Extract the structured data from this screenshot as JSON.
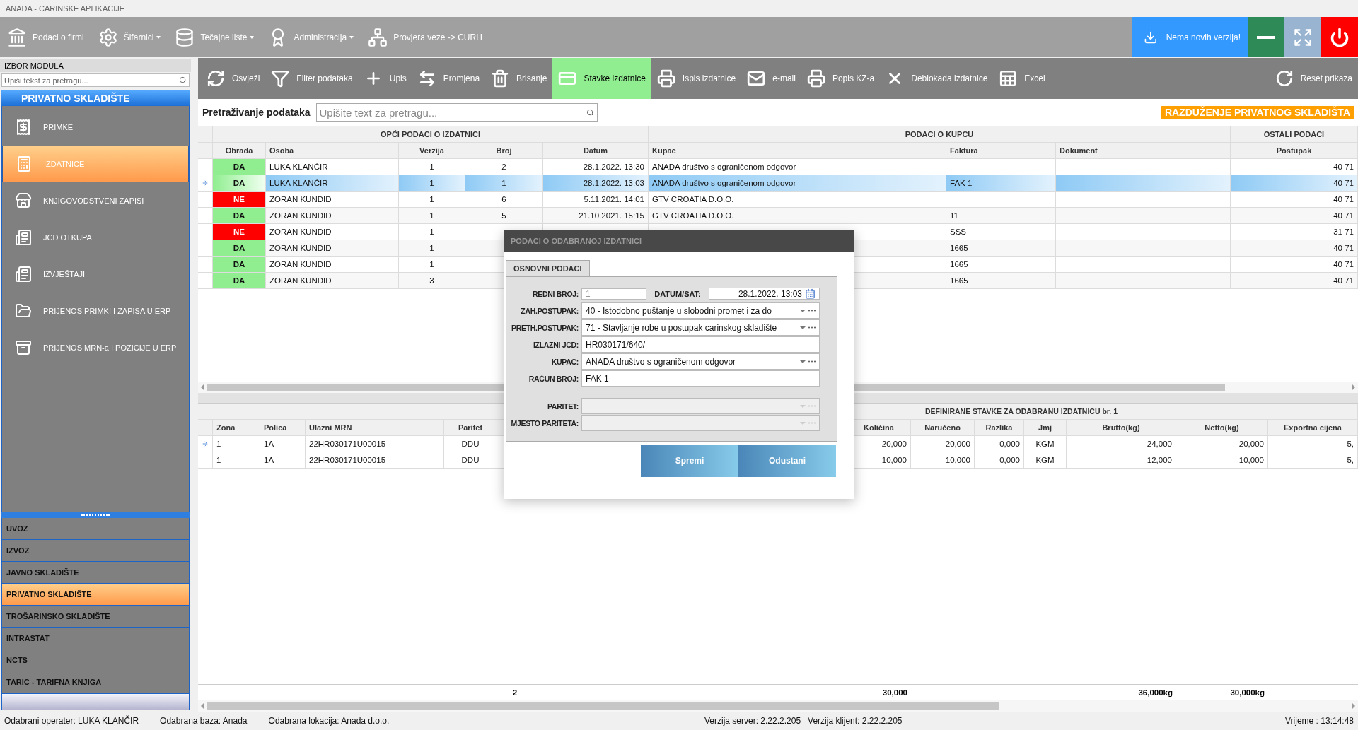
{
  "window": {
    "title": "ANADA - CARINSKE APLIKACIJE"
  },
  "main_menu": [
    {
      "label": "Podaci o firmi",
      "has_menu": false
    },
    {
      "label": "Šifarnici",
      "has_menu": true
    },
    {
      "label": "Tečajne liste",
      "has_menu": true
    },
    {
      "label": "Administracija",
      "has_menu": true
    },
    {
      "label": "Provjera veze -> CURH",
      "has_menu": false
    }
  ],
  "update_button": {
    "label": "Nema novih verzija!"
  },
  "sidebar": {
    "header": "IZBOR MODULA",
    "search": {
      "placeholder": "Upiši tekst za pretragu..."
    },
    "module_title": "PRIVATNO SKLADIŠTE",
    "items": [
      {
        "label": "PRIMKE",
        "selected": false
      },
      {
        "label": "IZDATNICE",
        "selected": true
      },
      {
        "label": "KNJIGOVODSTVENI ZAPISI",
        "selected": false
      },
      {
        "label": "JCD OTKUPA",
        "selected": false
      },
      {
        "label": "IZVJEŠTAJI",
        "selected": false
      },
      {
        "label": "PRIJENOS PRIMKI I ZAPISA U ERP",
        "selected": false
      },
      {
        "label": "PRIJENOS MRN-a I POZICIJE U ERP",
        "selected": false
      }
    ],
    "modules": [
      {
        "label": "UVOZ",
        "selected": false
      },
      {
        "label": "IZVOZ",
        "selected": false
      },
      {
        "label": "JAVNO SKLADIŠTE",
        "selected": false
      },
      {
        "label": "PRIVATNO SKLADIŠTE",
        "selected": true
      },
      {
        "label": "TROŠARINSKO SKLADIŠTE",
        "selected": false
      },
      {
        "label": "INTRASTAT",
        "selected": false
      },
      {
        "label": "NCTS",
        "selected": false
      },
      {
        "label": "TARIC - TARIFNA KNJIGA",
        "selected": false
      }
    ]
  },
  "toolbar": [
    {
      "label": "Osvježi",
      "selected": false
    },
    {
      "label": "Filter podataka",
      "selected": false
    },
    {
      "label": "Upis",
      "selected": false
    },
    {
      "label": "Promjena",
      "selected": false
    },
    {
      "label": "Brisanje",
      "selected": false
    },
    {
      "label": "Stavke izdatnice",
      "selected": true
    },
    {
      "label": "Ispis izdatnice",
      "selected": false
    },
    {
      "label": "e-mail",
      "selected": false
    },
    {
      "label": "Popis KZ-a",
      "selected": false
    },
    {
      "label": "Deblokada izdatnice",
      "selected": false
    },
    {
      "label": "Excel",
      "selected": false
    },
    {
      "label": "Reset prikaza",
      "selected": false
    }
  ],
  "search": {
    "label": "Pretraživanje podataka",
    "placeholder": "Upišite text za pretragu..."
  },
  "badge": "RAZDUŽENJE PRIVATNOG SKLADIŠTA",
  "documents_table": {
    "groups": [
      "OPĆI PODACI O IZDATNICI",
      "PODACI O KUPCU",
      "OSTALI PODACI"
    ],
    "columns": [
      "Obrada",
      "Osoba",
      "Verzija",
      "Broj",
      "Datum",
      "Kupac",
      "Faktura",
      "Dokument",
      "Postupak"
    ],
    "rows": [
      {
        "obrada": "DA",
        "approved": true,
        "selected": false,
        "osoba": "LUKA KLANČIR",
        "verzija": "1",
        "broj": "2",
        "datum": "28.1.2022. 13:30",
        "kupac": "ANADA društvo s ograničenom odgovor",
        "postupak": "40 71"
      },
      {
        "obrada": "DA",
        "approved": true,
        "selected": true,
        "osoba": "LUKA KLANČIR",
        "verzija": "1",
        "broj": "1",
        "datum": "28.1.2022. 13:03",
        "kupac": "ANADA društvo s ograničenom odgovor",
        "faktura": "FAK 1",
        "postupak": "40 71"
      },
      {
        "obrada": "NE",
        "approved": false,
        "selected": false,
        "osoba": "ZORAN KUNDID",
        "verzija": "1",
        "broj": "6",
        "datum": "5.11.2021. 14:01",
        "kupac": "GTV CROATIA D.O.O.",
        "postupak": "40 71"
      },
      {
        "obrada": "DA",
        "approved": true,
        "selected": false,
        "osoba": "ZORAN KUNDID",
        "verzija": "1",
        "broj": "5",
        "datum": "21.10.2021. 15:15",
        "kupac": "GTV CROATIA D.O.O.",
        "faktura": "11",
        "postupak": "40 71"
      },
      {
        "obrada": "NE",
        "approved": false,
        "selected": false,
        "osoba": "ZORAN KUNDID",
        "verzija": "1",
        "faktura": "SSS",
        "postupak": "31 71"
      },
      {
        "obrada": "DA",
        "approved": true,
        "selected": false,
        "osoba": "ZORAN KUNDID",
        "verzija": "1",
        "faktura": "1665",
        "postupak": "40 71"
      },
      {
        "obrada": "DA",
        "approved": true,
        "selected": false,
        "osoba": "ZORAN KUNDID",
        "verzija": "1",
        "faktura": "1665",
        "postupak": "40 71"
      },
      {
        "obrada": "DA",
        "approved": true,
        "selected": false,
        "osoba": "ZORAN KUNDID",
        "verzija": "3",
        "faktura": "1665",
        "postupak": "40 71"
      }
    ]
  },
  "items_table": {
    "title": "DEFINIRANE STAVKE ZA ODABRANU IZDATNICU br. 1",
    "columns": [
      "Zona",
      "Polica",
      "Ulazni MRN",
      "Paritet",
      "Količina",
      "Naručeno",
      "Razlika",
      "Jmj",
      "Brutto(kg)",
      "Netto(kg)",
      "Exportna cijena"
    ],
    "rows": [
      {
        "current": true,
        "cells": [
          "1",
          "1A",
          "22HR030171U00015",
          "DDU",
          "20,000",
          "20,000",
          "0,000",
          "KGM",
          "24,000",
          "20,000",
          "5,"
        ]
      },
      {
        "current": false,
        "cells": [
          "1",
          "1A",
          "22HR030171U00015",
          "DDU",
          "10,000",
          "10,000",
          "0,000",
          "KGM",
          "12,000",
          "10,000",
          "5,"
        ]
      }
    ],
    "totals": {
      "count": "2",
      "kolicina": "30,000",
      "brutto": "36,000kg",
      "netto": "30,000kg"
    }
  },
  "dialog": {
    "title": "PODACI O ODABRANOJ IZDATNICI",
    "tab": "OSNOVNI PODACI",
    "redni_broj": {
      "label": "REDNI BROJ:",
      "value": "1"
    },
    "datum": {
      "label": "DATUM/SAT:",
      "value": "28.1.2022. 13:03"
    },
    "fields": [
      {
        "label": "ZAH.POSTUPAK:",
        "value": "40 - Istodobno puštanje u slobodni promet i za do",
        "kind": "combo",
        "disabled": false
      },
      {
        "label": "PRETH.POSTUPAK:",
        "value": "71 - Stavljanje robe u postupak carinskog skladište",
        "kind": "combo",
        "disabled": false
      },
      {
        "label": "IZLAZNI JCD:",
        "value": "HR030171/640/",
        "kind": "text",
        "disabled": false
      },
      {
        "label": "KUPAC:",
        "value": "ANADA društvo s ograničenom odgovor",
        "kind": "combo",
        "disabled": false
      },
      {
        "label": "RAČUN BROJ:",
        "value": "FAK 1",
        "kind": "text",
        "disabled": false
      },
      {
        "label": "PARITET:",
        "kind": "combo",
        "disabled": true
      },
      {
        "label": "MJESTO PARITETA:",
        "kind": "combo",
        "disabled": true
      }
    ],
    "buttons": [
      "Spremi",
      "Odustani"
    ]
  },
  "status_bar": {
    "left": [
      "Odabrani operater: LUKA KLANČIR",
      "Odabrana baza: Anada",
      "Odabrana lokacija: Anada d.o.o."
    ],
    "center": [
      "Verzija server: 2.22.2.205",
      "Verzija klijent: 2.22.2.205"
    ],
    "right": "Vrijeme : 13:14:48"
  }
}
